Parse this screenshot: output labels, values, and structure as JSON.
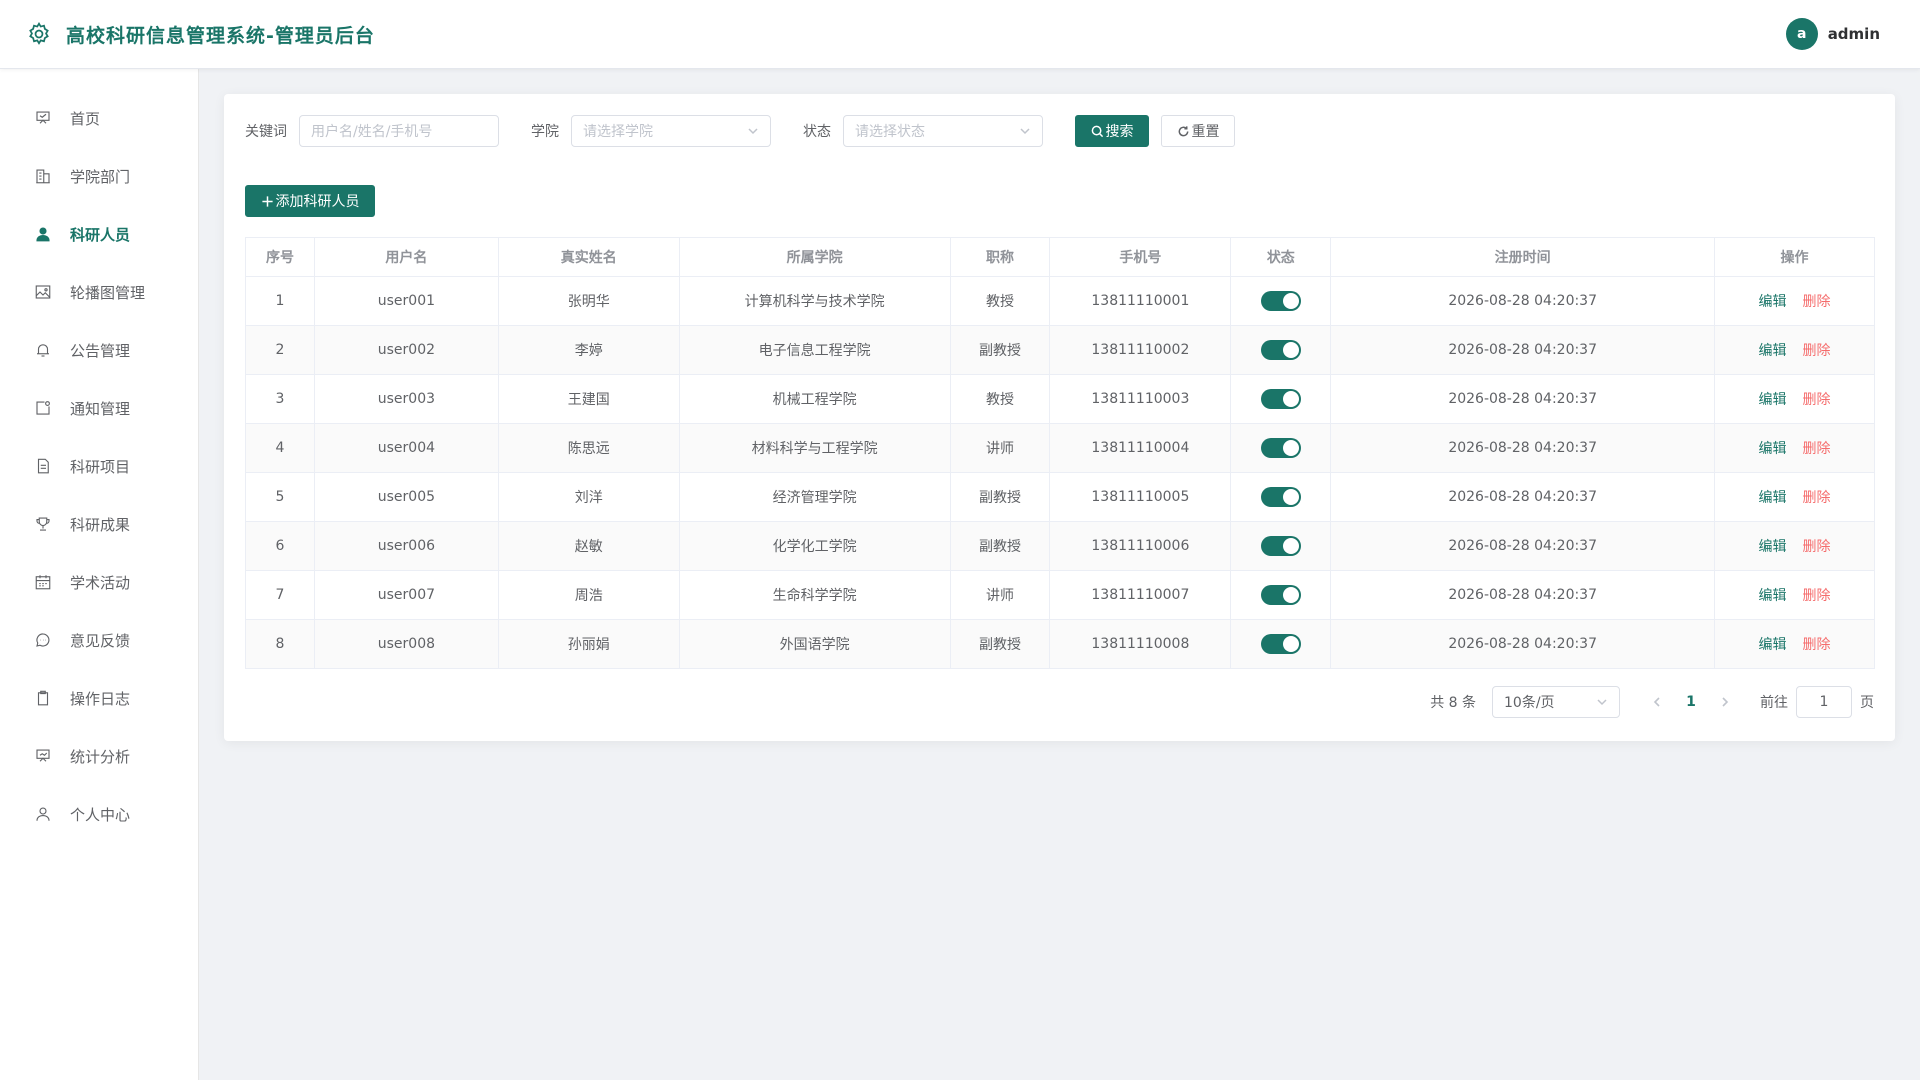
{
  "header": {
    "title": "高校科研信息管理系统-管理员后台",
    "avatar_letter": "a",
    "username": "admin"
  },
  "sidebar": {
    "items": [
      {
        "label": "首页",
        "icon": "home-icon"
      },
      {
        "label": "学院部门",
        "icon": "building-icon"
      },
      {
        "label": "科研人员",
        "icon": "user-icon",
        "active": true
      },
      {
        "label": "轮播图管理",
        "icon": "picture-icon"
      },
      {
        "label": "公告管理",
        "icon": "bell-icon"
      },
      {
        "label": "通知管理",
        "icon": "message-icon"
      },
      {
        "label": "科研项目",
        "icon": "document-icon"
      },
      {
        "label": "科研成果",
        "icon": "trophy-icon"
      },
      {
        "label": "学术活动",
        "icon": "calendar-icon"
      },
      {
        "label": "意见反馈",
        "icon": "chat-icon"
      },
      {
        "label": "操作日志",
        "icon": "clipboard-icon"
      },
      {
        "label": "统计分析",
        "icon": "chart-icon"
      },
      {
        "label": "个人中心",
        "icon": "person-icon"
      }
    ]
  },
  "filters": {
    "keyword_label": "关键词",
    "keyword_placeholder": "用户名/姓名/手机号",
    "college_label": "学院",
    "college_placeholder": "请选择学院",
    "status_label": "状态",
    "status_placeholder": "请选择状态",
    "search_label": "搜索",
    "reset_label": "重置"
  },
  "add_button": "添加科研人员",
  "table": {
    "headers": [
      "序号",
      "用户名",
      "真实姓名",
      "所属学院",
      "职称",
      "手机号",
      "状态",
      "注册时间",
      "操作"
    ],
    "rows": [
      {
        "index": "1",
        "username": "user001",
        "name": "张明华",
        "college": "计算机科学与技术学院",
        "title": "教授",
        "phone": "13811110001",
        "time": "2026-08-28 04:20:37"
      },
      {
        "index": "2",
        "username": "user002",
        "name": "李婷",
        "college": "电子信息工程学院",
        "title": "副教授",
        "phone": "13811110002",
        "time": "2026-08-28 04:20:37"
      },
      {
        "index": "3",
        "username": "user003",
        "name": "王建国",
        "college": "机械工程学院",
        "title": "教授",
        "phone": "13811110003",
        "time": "2026-08-28 04:20:37"
      },
      {
        "index": "4",
        "username": "user004",
        "name": "陈思远",
        "college": "材料科学与工程学院",
        "title": "讲师",
        "phone": "13811110004",
        "time": "2026-08-28 04:20:37"
      },
      {
        "index": "5",
        "username": "user005",
        "name": "刘洋",
        "college": "经济管理学院",
        "title": "副教授",
        "phone": "13811110005",
        "time": "2026-08-28 04:20:37"
      },
      {
        "index": "6",
        "username": "user006",
        "name": "赵敏",
        "college": "化学化工学院",
        "title": "副教授",
        "phone": "13811110006",
        "time": "2026-08-28 04:20:37"
      },
      {
        "index": "7",
        "username": "user007",
        "name": "周浩",
        "college": "生命科学学院",
        "title": "讲师",
        "phone": "13811110007",
        "time": "2026-08-28 04:20:37"
      },
      {
        "index": "8",
        "username": "user008",
        "name": "孙丽娟",
        "college": "外国语学院",
        "title": "副教授",
        "phone": "13811110008",
        "time": "2026-08-28 04:20:37"
      }
    ],
    "edit_label": "编辑",
    "delete_label": "删除"
  },
  "pagination": {
    "total": "共 8 条",
    "page_size": "10条/页",
    "current": "1",
    "goto_label": "前往",
    "goto_value": "1",
    "page_suffix": "页"
  },
  "colors": {
    "primary": "#1a7568",
    "danger": "#f56c6c"
  }
}
